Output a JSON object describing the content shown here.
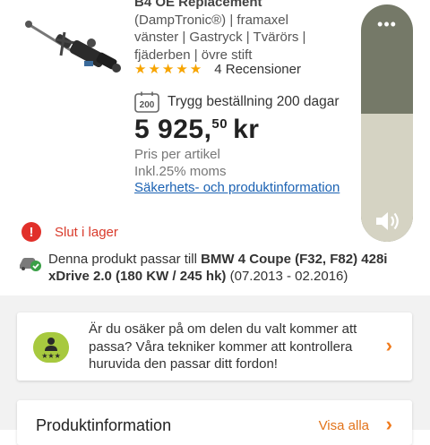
{
  "product": {
    "title_lines": [
      "B4 OE Replacement",
      "(DampTronic®) | framaxel",
      "vänster | Gastryck | Tvärörs |",
      "fjäderben | övre stift"
    ],
    "stars": "★★★★★",
    "reviews": "4 Recensioner",
    "delivery": "Trygg beställning 200 dagar",
    "delivery_badge": "200",
    "price_main": "5 925,",
    "price_cents": "50",
    "price_currency": "kr",
    "price_per": "Pris per artikel",
    "vat": "Inkl.25% moms",
    "info_link": "Säkerhets- och produktinformation"
  },
  "stock": {
    "icon": "exclamation-icon",
    "text": "Slut i lager"
  },
  "fit": {
    "prefix": "Denna produkt passar till ",
    "vehicle": "BMW 4 Coupe (F32, F82) 428i xDrive 2.0 (180 KW / 245 hk)",
    "years": " (07.2013 - 02.2016)"
  },
  "tech_card": {
    "text": "Är du osäker på om delen du valt kommer att passa? Våra tekniker kommer att kontrollera huruvida den passar ditt fordon!"
  },
  "product_info": {
    "title": "Produktinformation",
    "show_all": "Visa alla"
  },
  "volume_overlay": {
    "menu": "•••",
    "level": 0.54
  },
  "colors": {
    "accent_orange": "#f07b1d",
    "link_blue": "#1b62b3",
    "stars": "#f7a400",
    "alert_red": "#e1302a",
    "tech_green": "#a7c93f"
  }
}
